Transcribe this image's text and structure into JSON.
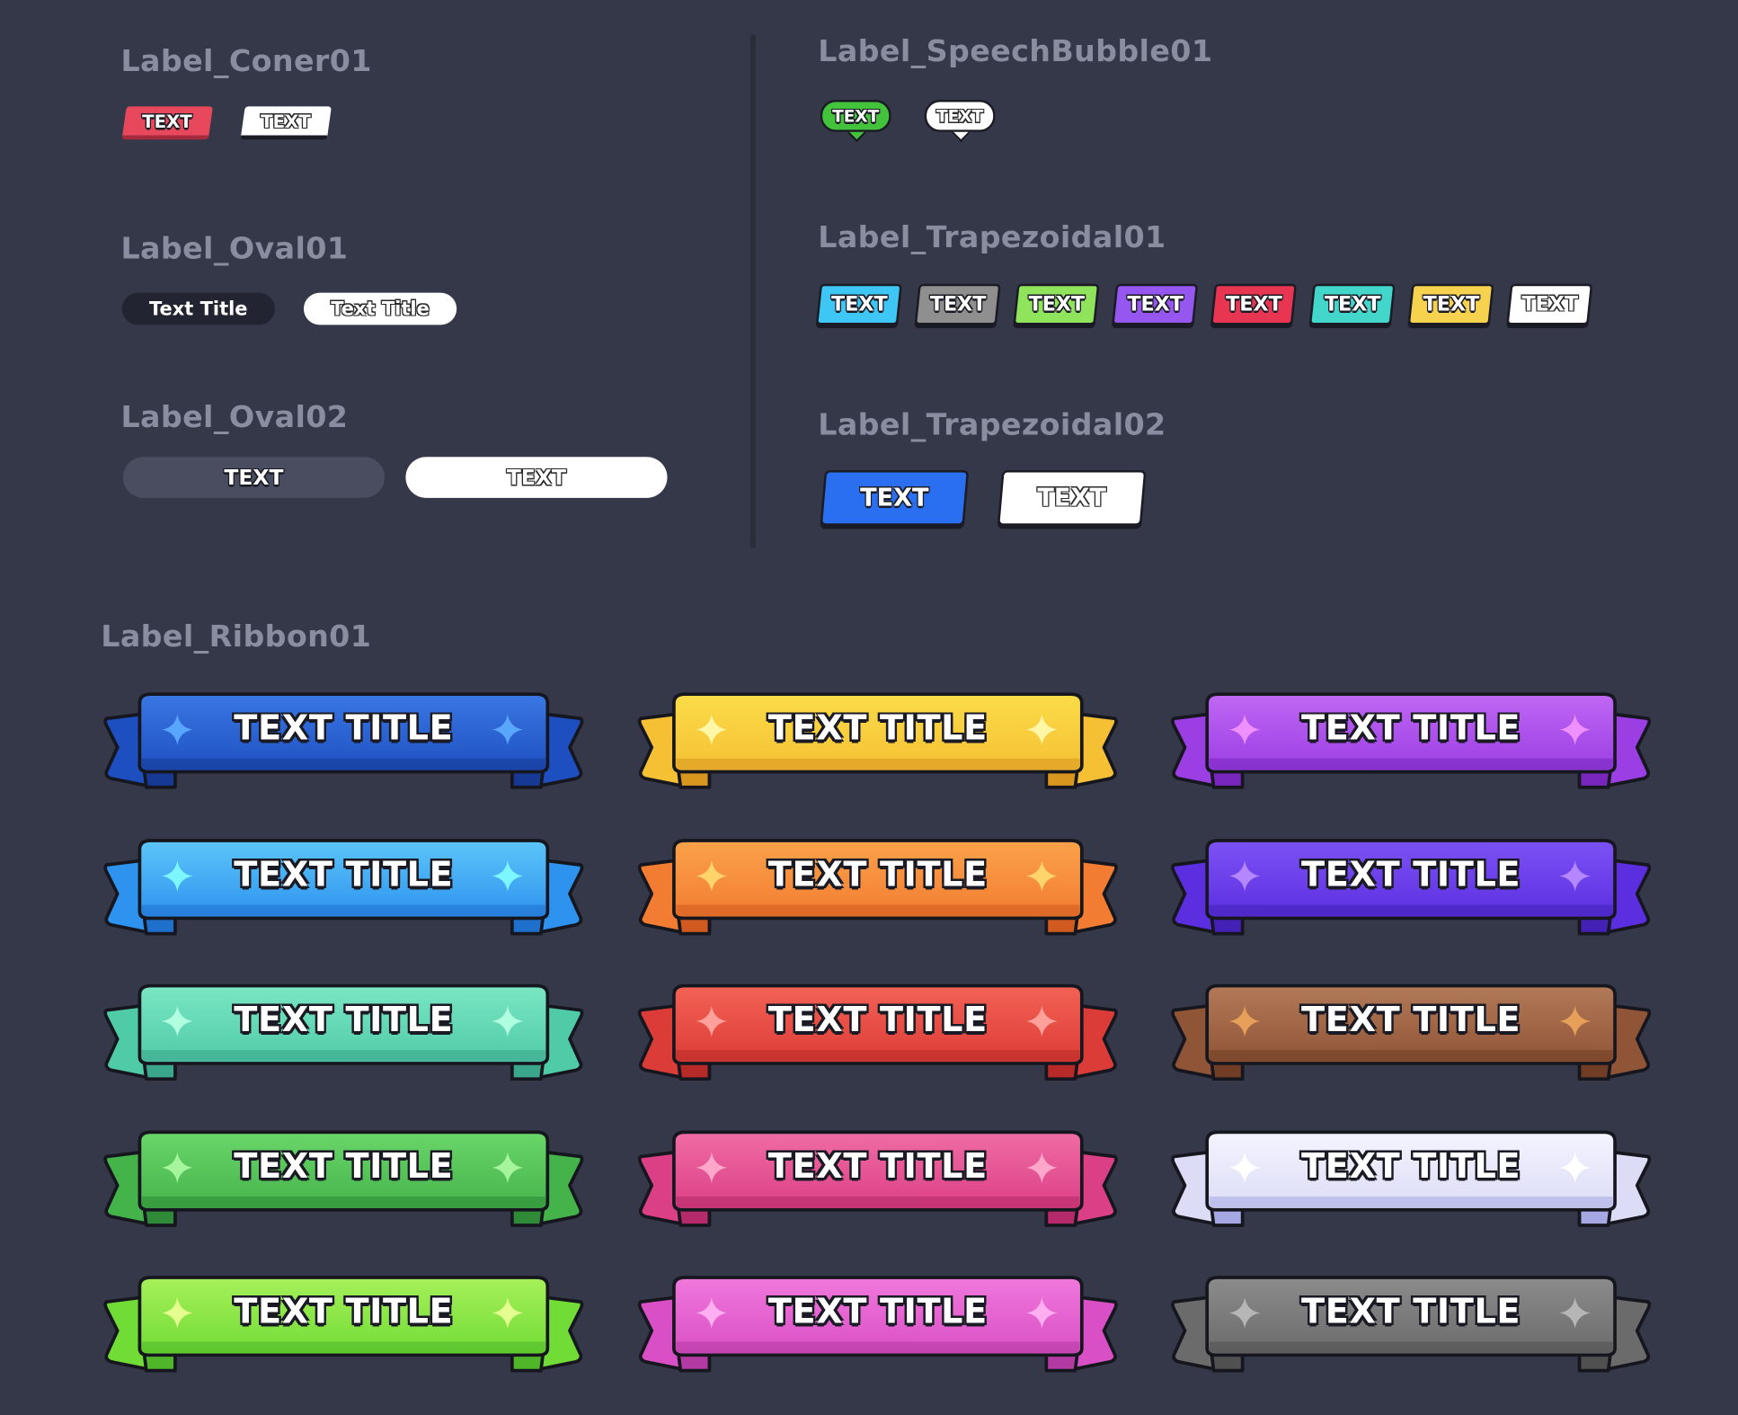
{
  "sections": {
    "corner": "Label_Coner01",
    "oval1": "Label_Oval01",
    "oval2": "Label_Oval02",
    "speech": "Label_SpeechBubble01",
    "trap1": "Label_Trapezoidal01",
    "trap2": "Label_Trapezoidal02",
    "ribbon": "Label_Ribbon01"
  },
  "corner_labels": [
    {
      "text": "TEXT",
      "color": "#e8485c"
    },
    {
      "text": "TEXT",
      "color": "#ffffff"
    }
  ],
  "oval1_labels": [
    {
      "text": "Text Title",
      "color": "#222431"
    },
    {
      "text": "Text Title",
      "color": "#ffffff"
    }
  ],
  "oval2_labels": [
    {
      "text": "TEXT",
      "color": "#4a4c60"
    },
    {
      "text": "TEXT",
      "color": "#ffffff"
    }
  ],
  "speech_labels": [
    {
      "text": "TEXT",
      "color": "#43c33c"
    },
    {
      "text": "TEXT",
      "color": "#ffffff"
    }
  ],
  "trap1_labels": [
    {
      "text": "TEXT",
      "color": "#3ec6f5"
    },
    {
      "text": "TEXT",
      "color": "#8f8f8f"
    },
    {
      "text": "TEXT",
      "color": "#8fe45c"
    },
    {
      "text": "TEXT",
      "color": "#9656f0"
    },
    {
      "text": "TEXT",
      "color": "#e83552"
    },
    {
      "text": "TEXT",
      "color": "#43d7cb"
    },
    {
      "text": "TEXT",
      "color": "#f6d24e"
    },
    {
      "text": "TEXT",
      "color": "#ffffff"
    }
  ],
  "trap2_labels": [
    {
      "text": "TEXT",
      "color": "#2a6ff0"
    },
    {
      "text": "TEXT",
      "color": "#ffffff"
    }
  ],
  "ribbons": [
    {
      "text": "TEXT TITLE",
      "top": "#3a78e4",
      "bottom": "#1e4fc0",
      "dark": "#163a94",
      "star": "#59a6ff"
    },
    {
      "text": "TEXT TITLE",
      "top": "#fbdc48",
      "bottom": "#f5c034",
      "dark": "#d9961f",
      "star": "#fff6a6"
    },
    {
      "text": "TEXT TITLE",
      "top": "#c067f3",
      "bottom": "#9b3ee4",
      "dark": "#7826be",
      "star": "#ee90ff"
    },
    {
      "text": "TEXT TITLE",
      "top": "#5cc6f8",
      "bottom": "#2e92ef",
      "dark": "#1f6fcc",
      "star": "#7ef6ff"
    },
    {
      "text": "TEXT TITLE",
      "top": "#fba24a",
      "bottom": "#f27c31",
      "dark": "#d05a1f",
      "star": "#ffd46b"
    },
    {
      "text": "TEXT TITLE",
      "top": "#7d52f4",
      "bottom": "#5b2fe0",
      "dark": "#4320b6",
      "star": "#b487ff"
    },
    {
      "text": "TEXT TITLE",
      "top": "#7ae6c2",
      "bottom": "#50cba8",
      "dark": "#3aa68a",
      "star": "#b0ffe0"
    },
    {
      "text": "TEXT TITLE",
      "top": "#f36255",
      "bottom": "#dc3c37",
      "dark": "#b82a27",
      "star": "#ffa09a"
    },
    {
      "text": "TEXT TITLE",
      "top": "#b27a58",
      "bottom": "#905436",
      "dark": "#6f3e25",
      "star": "#e7a05a"
    },
    {
      "text": "TEXT TITLE",
      "top": "#6ad66a",
      "bottom": "#44b34a",
      "dark": "#2e8a36",
      "star": "#a6f59c"
    },
    {
      "text": "TEXT TITLE",
      "top": "#f06ca4",
      "bottom": "#db3f85",
      "dark": "#b42a6a",
      "star": "#ffa6cb"
    },
    {
      "text": "TEXT TITLE",
      "top": "#f4f4ff",
      "bottom": "#dcdcf6",
      "dark": "#a6a8e4",
      "star": "#ffffff"
    },
    {
      "text": "TEXT TITLE",
      "top": "#a6f05a",
      "bottom": "#71dc35",
      "dark": "#4fb62a",
      "star": "#e4ff8f"
    },
    {
      "text": "TEXT TITLE",
      "top": "#f078dc",
      "bottom": "#d94fc5",
      "dark": "#b23aa2",
      "star": "#ffaef0"
    },
    {
      "text": "TEXT TITLE",
      "top": "#8b8b8b",
      "bottom": "#6b6b6b",
      "dark": "#505050",
      "star": "#b6b6b6"
    }
  ]
}
